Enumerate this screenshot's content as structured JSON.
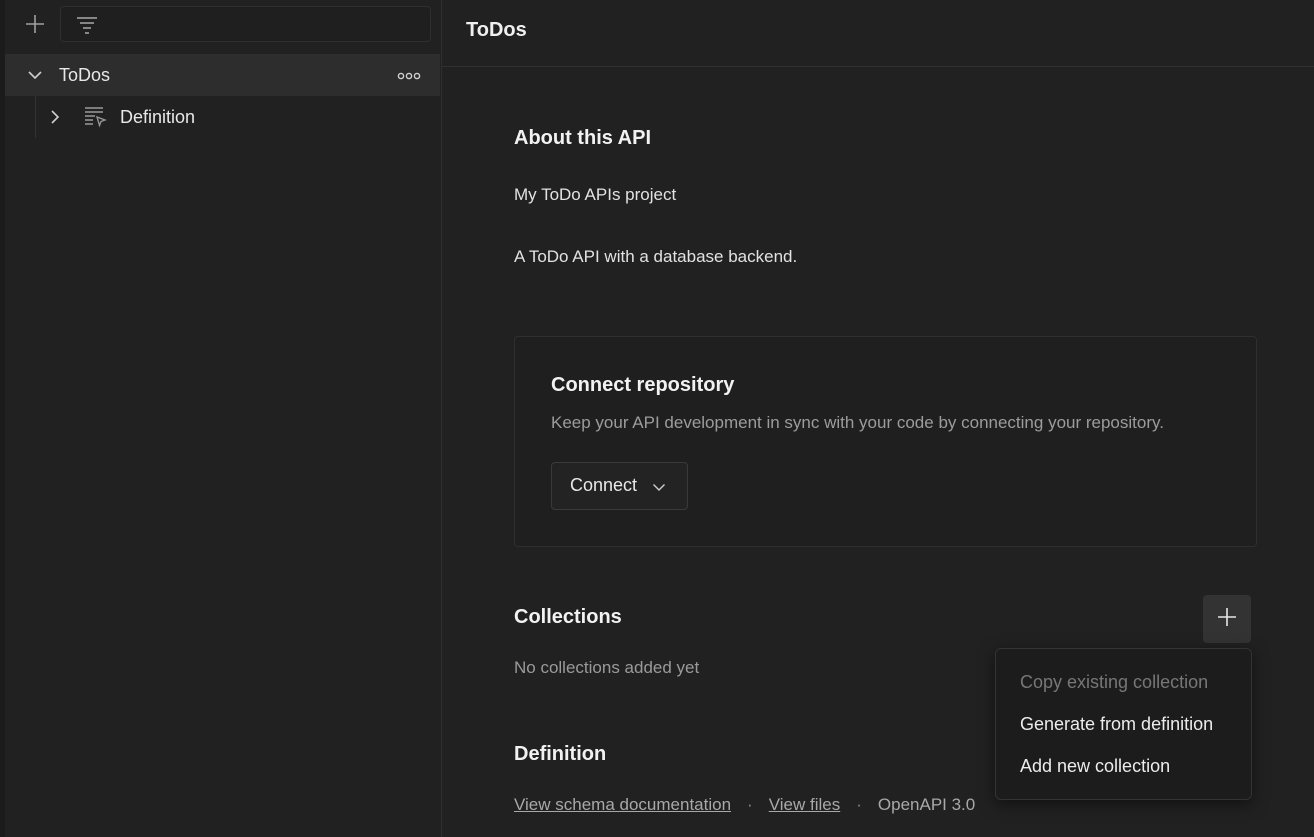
{
  "sidebar": {
    "tree": [
      {
        "label": "ToDos",
        "expanded": true,
        "selected": true
      },
      {
        "label": "Definition",
        "expanded": false
      }
    ]
  },
  "main": {
    "title": "ToDos",
    "about": {
      "heading": "About this API",
      "summary": "My ToDo APIs project",
      "description": "A ToDo API with a database backend."
    },
    "repository": {
      "heading": "Connect repository",
      "description": "Keep your API development in sync with your code by connecting your repository.",
      "connect_label": "Connect"
    },
    "collections": {
      "heading": "Collections",
      "empty_text": "No collections added yet"
    },
    "definition": {
      "heading": "Definition",
      "schema_link": "View schema documentation",
      "files_link": "View files",
      "separator": "·",
      "format": "OpenAPI 3.0"
    }
  },
  "menu": {
    "items": [
      {
        "label": "Copy existing collection",
        "disabled": true
      },
      {
        "label": "Generate from definition",
        "disabled": false
      },
      {
        "label": "Add new collection",
        "disabled": false
      }
    ]
  },
  "colors": {
    "background": "#212121",
    "selected_row": "#2d2d2d",
    "muted_text": "#9a9a9a"
  }
}
